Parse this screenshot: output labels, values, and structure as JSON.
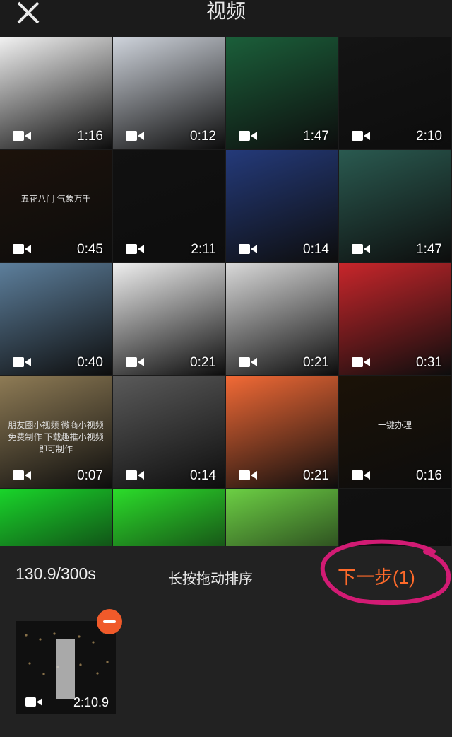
{
  "header": {
    "title": "视频",
    "close_icon": "close-icon"
  },
  "grid": [
    {
      "duration": "1:16",
      "thumb_color": "#f2f2f2"
    },
    {
      "duration": "0:12",
      "thumb_color": "#cfd4dc"
    },
    {
      "duration": "1:47",
      "thumb_color": "#1b5f3a"
    },
    {
      "duration": "2:10",
      "thumb_color": "#141414"
    },
    {
      "duration": "0:45",
      "thumb_color": "#1c120b",
      "overlay_text": "五花八门 气象万千"
    },
    {
      "duration": "2:11",
      "thumb_color": "#111111"
    },
    {
      "duration": "0:14",
      "thumb_color": "#243a7a"
    },
    {
      "duration": "1:47",
      "thumb_color": "#2a5a50"
    },
    {
      "duration": "0:40",
      "thumb_color": "#5d7f9c"
    },
    {
      "duration": "0:21",
      "thumb_color": "#efefef"
    },
    {
      "duration": "0:21",
      "thumb_color": "#d9d9d9"
    },
    {
      "duration": "0:31",
      "thumb_color": "#c8262b"
    },
    {
      "duration": "0:07",
      "thumb_color": "#8e7b55",
      "overlay_text": "朋友圈小视频 微商小视频 免费制作 下载趣推小视频即可制作"
    },
    {
      "duration": "0:14",
      "thumb_color": "#5a5a5a"
    },
    {
      "duration": "0:21",
      "thumb_color": "#f26a36"
    },
    {
      "duration": "0:16",
      "thumb_color": "#1b1207",
      "overlay_text": "一键办理"
    },
    {
      "duration": "",
      "thumb_color": "#19d42a"
    },
    {
      "duration": "",
      "thumb_color": "#2bdc2a"
    },
    {
      "duration": "",
      "thumb_color": "#6ccf44"
    },
    {
      "duration": "",
      "thumb_color": "#111111"
    }
  ],
  "bottom": {
    "used_time": "130.9/300s",
    "hint": "长按拖动排序",
    "next_label": "下一步(1)",
    "selected_duration": "2:10.9"
  },
  "colors": {
    "accent": "#ff6a2a",
    "annotation_circle": "#d21b74",
    "background": "#1b1b1b"
  }
}
